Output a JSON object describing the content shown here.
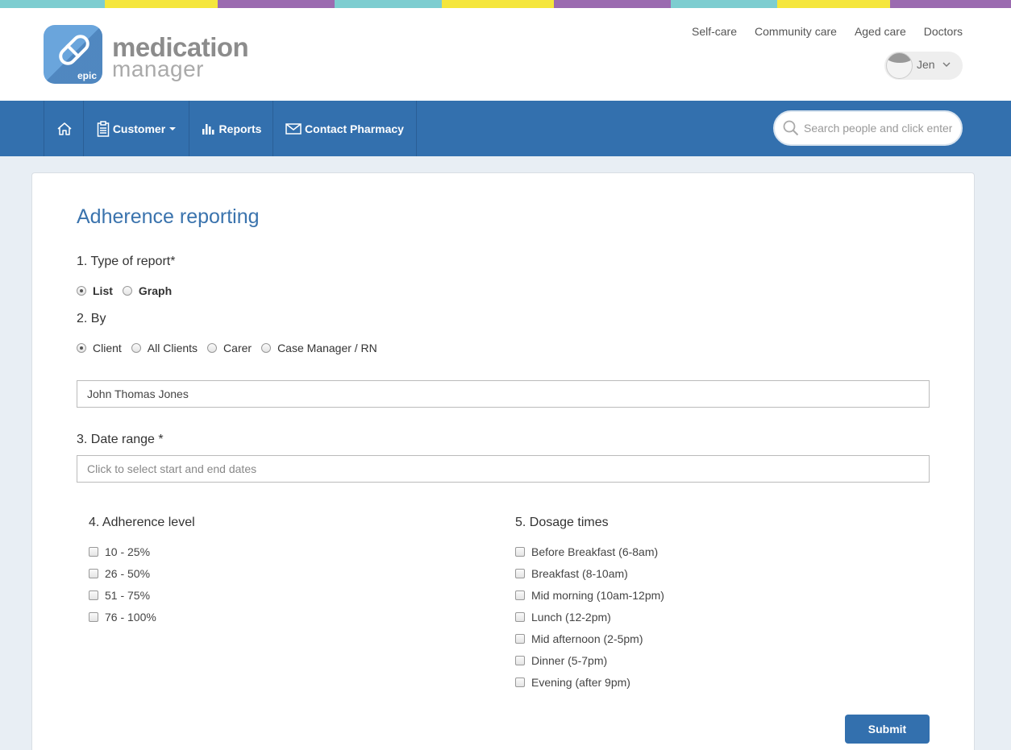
{
  "stripe_colors": [
    "#7dcdd0",
    "#f5e63c",
    "#9b6bb0",
    "#7dcdd0",
    "#f5e63c",
    "#9b6bb0",
    "#7dcdd0",
    "#f5e63c",
    "#9b6bb0"
  ],
  "brand": {
    "epic": "epic",
    "line1": "medication",
    "line2": "manager",
    "logo_color": "#6aa5dc"
  },
  "top_links": [
    "Self-care",
    "Community care",
    "Aged care",
    "Doctors"
  ],
  "user": {
    "name": "Jen"
  },
  "nav": {
    "customer": "Customer",
    "reports": "Reports",
    "contact": "Contact Pharmacy",
    "search_placeholder": "Search people and click enter",
    "color": "#3370ae"
  },
  "form": {
    "title": "Adherence reporting",
    "type_label": "1. Type of report*",
    "type_options": [
      "List",
      "Graph"
    ],
    "type_selected": "List",
    "by_label": "2. By",
    "by_options": [
      "Client",
      "All Clients",
      "Carer",
      "Case Manager / RN"
    ],
    "by_selected": "Client",
    "client_value": "John Thomas Jones",
    "date_label": "3. Date range *",
    "date_placeholder": "Click to select start and end dates",
    "adherence_label": "4. Adherence level",
    "adherence_options": [
      "10 - 25%",
      "26 - 50%",
      "51 - 75%",
      "76 - 100%"
    ],
    "dosage_label": "5. Dosage times",
    "dosage_options": [
      "Before Breakfast (6-8am)",
      "Breakfast (8-10am)",
      "Mid morning (10am-12pm)",
      "Lunch (12-2pm)",
      "Mid afternoon (2-5pm)",
      "Dinner (5-7pm)",
      "Evening (after 9pm)"
    ],
    "submit": "Submit"
  }
}
